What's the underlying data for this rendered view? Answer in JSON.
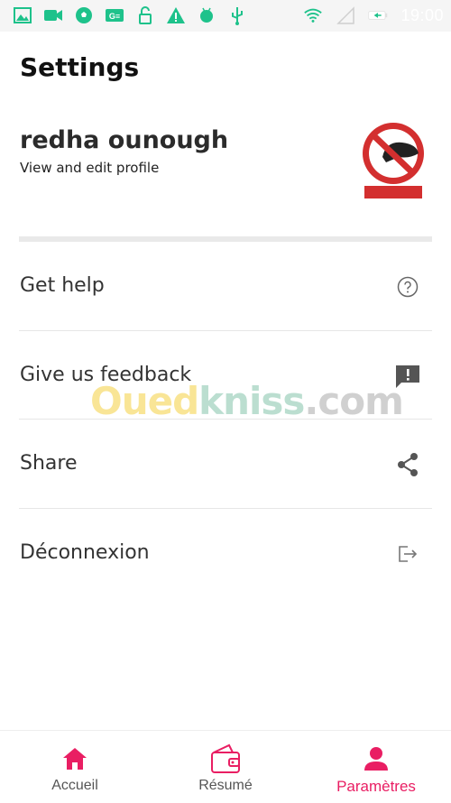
{
  "status_bar": {
    "time": "19:00",
    "icons": [
      "image-icon",
      "video-icon",
      "soccer-icon",
      "g-icon",
      "lock-open-icon",
      "warning-icon",
      "android-icon",
      "usb-icon",
      "wifi-icon",
      "signal-icon",
      "battery-icon"
    ]
  },
  "header": {
    "title": "Settings"
  },
  "profile": {
    "name": "redha ounough",
    "subtitle": "View and edit profile"
  },
  "menu": {
    "items": [
      {
        "label": "Get help",
        "icon": "help-circle-icon"
      },
      {
        "label": "Give us feedback",
        "icon": "feedback-icon"
      },
      {
        "label": "Share",
        "icon": "share-icon"
      },
      {
        "label": "Déconnexion",
        "icon": "logout-icon"
      }
    ]
  },
  "watermark": {
    "part1": "Oued",
    "part2": "kniss",
    "part3": ".com"
  },
  "bottom_nav": {
    "items": [
      {
        "label": "Accueil",
        "icon": "home-icon",
        "active": false
      },
      {
        "label": "Résumé",
        "icon": "wallet-icon",
        "active": false
      },
      {
        "label": "Paramètres",
        "icon": "person-icon",
        "active": true
      }
    ]
  },
  "colors": {
    "accent": "#e91e63",
    "status_icon": "#1ec28b",
    "text_primary": "#333333",
    "divider": "#e6e6e6"
  }
}
